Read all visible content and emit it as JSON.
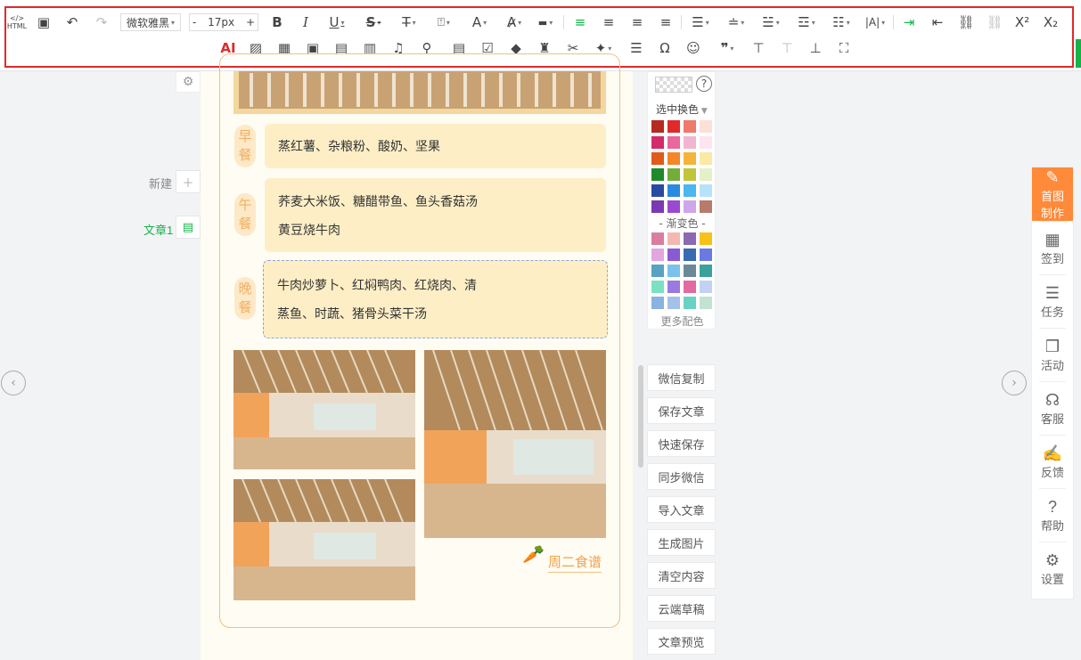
{
  "toolbar": {
    "font_name": "微软雅黑",
    "font_size": "17px",
    "font_size_minus": "-",
    "font_size_plus": "+",
    "ai_label": "AI",
    "html_label": "HTML"
  },
  "left": {
    "new_label": "新建",
    "article_label": "文章1"
  },
  "menu": {
    "breakfast_tag": "早餐",
    "breakfast_items": [
      "蒸红薯、杂粮粉、酸奶、坚果"
    ],
    "lunch_tag": "午餐",
    "lunch_items": [
      "荞麦大米饭、糖醋带鱼、鱼头香菇汤",
      "黄豆烧牛肉"
    ],
    "dinner_tag": "晚餐",
    "dinner_items": [
      "牛肉炒萝卜、红焖鸭肉、红烧肉、清",
      "蒸鱼、时蔬、猪骨头菜干汤"
    ],
    "caption": "周二食谱"
  },
  "palette": {
    "select_label": "选中换色",
    "gradient_label": "- 渐变色 -",
    "more_label": "更多配色",
    "help_icon": "?",
    "solid_rows": [
      [
        "#b52a1e",
        "#e02a2a",
        "#ee7a6c",
        "#fde0d8"
      ],
      [
        "#d42a6a",
        "#e9679a",
        "#f2b5cf",
        "#fde4ee"
      ],
      [
        "#e05a1a",
        "#f5862a",
        "#f6b33a",
        "#fbe9a6"
      ],
      [
        "#1f8a2a",
        "#73ad3a",
        "#c1c53a",
        "#e4f0c6"
      ],
      [
        "#2a4aa2",
        "#2a8ae0",
        "#4ab7ee",
        "#b8e2fa"
      ],
      [
        "#7a3ab2",
        "#9a4ad2",
        "#cfa6ea",
        "#b87a6a"
      ]
    ],
    "gradient_rows": [
      [
        "#d97ea0",
        "#f5b8b0",
        "#8a6ab2",
        "#f5c21a"
      ],
      [
        "#e2a6e2",
        "#8a5ad2",
        "#3a6ab2",
        "#6a7ae2"
      ],
      [
        "#5aa2c2",
        "#7ac2ea",
        "#6a8a9a",
        "#3aa29a"
      ],
      [
        "#7ae2c2",
        "#9a7ae2",
        "#e26aa2",
        "#c2d2f2"
      ],
      [
        "#8ab2e2",
        "#a2c2ea",
        "#6ad2c2",
        "#c2e2d2"
      ]
    ]
  },
  "actions": [
    "微信复制",
    "保存文章",
    "快速保存",
    "同步微信",
    "导入文章",
    "生成图片",
    "清空内容",
    "云端草稿",
    "文章预览"
  ],
  "rightnav": [
    {
      "icon": "✎",
      "label1": "首图",
      "label2": "制作"
    },
    {
      "icon": "▦",
      "label1": "签到",
      "label2": ""
    },
    {
      "icon": "☰",
      "label1": "任务",
      "label2": ""
    },
    {
      "icon": "❒",
      "label1": "活动",
      "label2": ""
    },
    {
      "icon": "☊",
      "label1": "客服",
      "label2": ""
    },
    {
      "icon": "✍",
      "label1": "反馈",
      "label2": ""
    },
    {
      "icon": "?",
      "label1": "帮助",
      "label2": ""
    },
    {
      "icon": "⚙",
      "label1": "设置",
      "label2": ""
    }
  ],
  "colors": {
    "accent_green": "#17b34a",
    "highlight_red": "#e02a2a",
    "brand_orange": "#ff8a3a"
  }
}
